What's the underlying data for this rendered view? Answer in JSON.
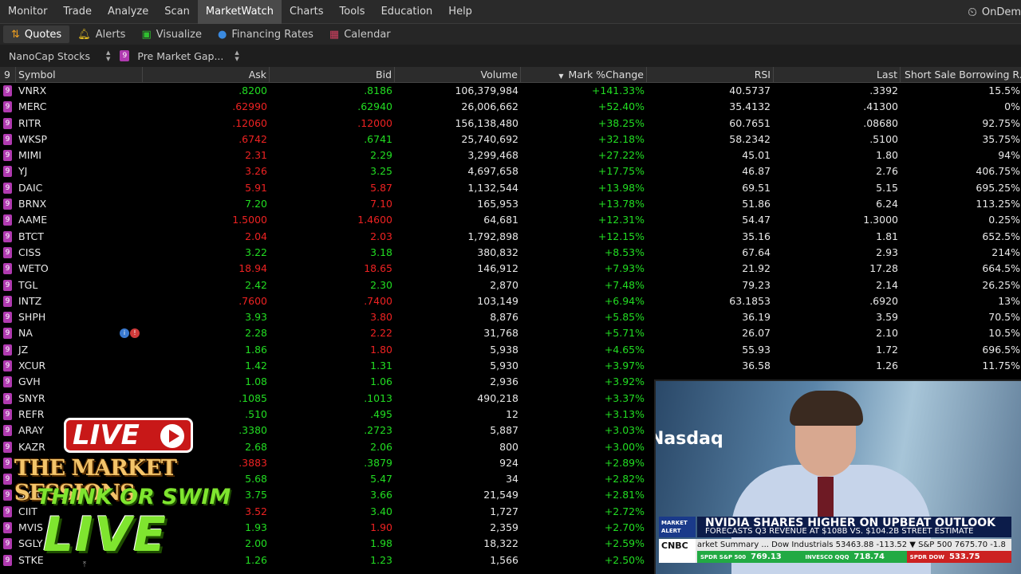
{
  "menu": {
    "items": [
      "Monitor",
      "Trade",
      "Analyze",
      "Scan",
      "MarketWatch",
      "Charts",
      "Tools",
      "Education",
      "Help"
    ],
    "active_index": 4,
    "right_label": "OnDem"
  },
  "subtabs": [
    {
      "label": "Quotes",
      "icon": "sort-arrows-icon",
      "active": true
    },
    {
      "label": "Alerts",
      "icon": "bell-icon",
      "active": false
    },
    {
      "label": "Visualize",
      "icon": "chart-icon",
      "active": false
    },
    {
      "label": "Financing Rates",
      "icon": "globe-icon",
      "active": false
    },
    {
      "label": "Calendar",
      "icon": "calendar-icon",
      "active": false
    }
  ],
  "watchlist": {
    "name": "NanoCap Stocks",
    "scan_name": "Pre Market Gap...",
    "tag": "9"
  },
  "table": {
    "count_label": "9",
    "headers": {
      "symbol": "Symbol",
      "ask": "Ask",
      "bid": "Bid",
      "volume": "Volume",
      "mark_change": "Mark %Change",
      "rsi": "RSI",
      "last": "Last",
      "short": "Short Sale Borrowing R..."
    },
    "rows": [
      {
        "sym": "VNRX",
        "ask": ".8200",
        "ask_c": "g",
        "bid": ".8186",
        "bid_c": "g",
        "vol": "106,379,984",
        "chg": "+141.33%",
        "rsi": "40.5737",
        "last": ".3392",
        "short": "15.5%"
      },
      {
        "sym": "MERC",
        "ask": ".62990",
        "ask_c": "rd",
        "bid": ".62940",
        "bid_c": "g",
        "vol": "26,006,662",
        "chg": "+52.40%",
        "rsi": "35.4132",
        "last": ".41300",
        "short": "0%"
      },
      {
        "sym": "RITR",
        "ask": ".12060",
        "ask_c": "rd",
        "bid": ".12000",
        "bid_c": "rd",
        "vol": "156,138,480",
        "chg": "+38.25%",
        "rsi": "60.7651",
        "last": ".08680",
        "short": "92.75%"
      },
      {
        "sym": "WKSP",
        "ask": ".6742",
        "ask_c": "rd",
        "bid": ".6741",
        "bid_c": "g",
        "vol": "25,740,692",
        "chg": "+32.18%",
        "rsi": "58.2342",
        "last": ".5100",
        "short": "35.75%"
      },
      {
        "sym": "MIMI",
        "ask": "2.31",
        "ask_c": "rd",
        "bid": "2.29",
        "bid_c": "g",
        "vol": "3,299,468",
        "chg": "+27.22%",
        "rsi": "45.01",
        "last": "1.80",
        "short": "94%"
      },
      {
        "sym": "YJ",
        "ask": "3.26",
        "ask_c": "rd",
        "bid": "3.25",
        "bid_c": "g",
        "vol": "4,697,658",
        "chg": "+17.75%",
        "rsi": "46.87",
        "last": "2.76",
        "short": "406.75%"
      },
      {
        "sym": "DAIC",
        "ask": "5.91",
        "ask_c": "rd",
        "bid": "5.87",
        "bid_c": "rd",
        "vol": "1,132,544",
        "chg": "+13.98%",
        "rsi": "69.51",
        "last": "5.15",
        "short": "695.25%"
      },
      {
        "sym": "BRNX",
        "ask": "7.20",
        "ask_c": "g",
        "bid": "7.10",
        "bid_c": "rd",
        "vol": "165,953",
        "chg": "+13.78%",
        "rsi": "51.86",
        "last": "6.24",
        "short": "113.25%"
      },
      {
        "sym": "AAME",
        "ask": "1.5000",
        "ask_c": "rd",
        "bid": "1.4600",
        "bid_c": "rd",
        "vol": "64,681",
        "chg": "+12.31%",
        "rsi": "54.47",
        "last": "1.3000",
        "short": "0.25%"
      },
      {
        "sym": "BTCT",
        "ask": "2.04",
        "ask_c": "rd",
        "bid": "2.03",
        "bid_c": "rd",
        "vol": "1,792,898",
        "chg": "+12.15%",
        "rsi": "35.16",
        "last": "1.81",
        "short": "652.5%"
      },
      {
        "sym": "CISS",
        "ask": "3.22",
        "ask_c": "g",
        "bid": "3.18",
        "bid_c": "g",
        "vol": "380,832",
        "chg": "+8.53%",
        "rsi": "67.64",
        "last": "2.93",
        "short": "214%"
      },
      {
        "sym": "WETO",
        "ask": "18.94",
        "ask_c": "rd",
        "bid": "18.65",
        "bid_c": "rd",
        "vol": "146,912",
        "chg": "+7.93%",
        "rsi": "21.92",
        "last": "17.28",
        "short": "664.5%"
      },
      {
        "sym": "TGL",
        "ask": "2.42",
        "ask_c": "g",
        "bid": "2.30",
        "bid_c": "g",
        "vol": "2,870",
        "chg": "+7.48%",
        "rsi": "79.23",
        "last": "2.14",
        "short": "26.25%"
      },
      {
        "sym": "INTZ",
        "ask": ".7600",
        "ask_c": "rd",
        "bid": ".7400",
        "bid_c": "rd",
        "vol": "103,149",
        "chg": "+6.94%",
        "rsi": "63.1853",
        "last": ".6920",
        "short": "13%"
      },
      {
        "sym": "SHPH",
        "ask": "3.93",
        "ask_c": "g",
        "bid": "3.80",
        "bid_c": "rd",
        "vol": "8,876",
        "chg": "+5.85%",
        "rsi": "36.19",
        "last": "3.59",
        "short": "70.5%"
      },
      {
        "sym": "NA",
        "ask": "2.28",
        "ask_c": "g",
        "bid": "2.22",
        "bid_c": "rd",
        "vol": "31,768",
        "chg": "+5.71%",
        "rsi": "26.07",
        "last": "2.10",
        "short": "10.5%",
        "badges": true
      },
      {
        "sym": "JZ",
        "ask": "1.86",
        "ask_c": "g",
        "bid": "1.80",
        "bid_c": "rd",
        "vol": "5,938",
        "chg": "+4.65%",
        "rsi": "55.93",
        "last": "1.72",
        "short": "696.5%"
      },
      {
        "sym": "XCUR",
        "ask": "1.42",
        "ask_c": "g",
        "bid": "1.31",
        "bid_c": "g",
        "vol": "5,930",
        "chg": "+3.97%",
        "rsi": "36.58",
        "last": "1.26",
        "short": "11.75%"
      },
      {
        "sym": "GVH",
        "ask": "1.08",
        "ask_c": "g",
        "bid": "1.06",
        "bid_c": "g",
        "vol": "2,936",
        "chg": "+3.92%",
        "rsi": "",
        "last": "",
        "short": ""
      },
      {
        "sym": "SNYR",
        "ask": ".1085",
        "ask_c": "g",
        "bid": ".1013",
        "bid_c": "g",
        "vol": "490,218",
        "chg": "+3.37%",
        "rsi": "",
        "last": "",
        "short": ""
      },
      {
        "sym": "REFR",
        "ask": ".510",
        "ask_c": "g",
        "bid": ".495",
        "bid_c": "g",
        "vol": "12",
        "chg": "+3.13%",
        "rsi": "",
        "last": "",
        "short": ""
      },
      {
        "sym": "ARAY",
        "ask": ".3380",
        "ask_c": "g",
        "bid": ".2723",
        "bid_c": "g",
        "vol": "5,887",
        "chg": "+3.03%",
        "rsi": "",
        "last": "",
        "short": ""
      },
      {
        "sym": "KAZR",
        "ask": "2.68",
        "ask_c": "g",
        "bid": "2.06",
        "bid_c": "g",
        "vol": "800",
        "chg": "+3.00%",
        "rsi": "",
        "last": "",
        "short": ""
      },
      {
        "sym": "",
        "ask": ".3883",
        "ask_c": "rd",
        "bid": ".3879",
        "bid_c": "g",
        "vol": "924",
        "chg": "+2.89%",
        "rsi": "",
        "last": "",
        "short": ""
      },
      {
        "sym": "",
        "ask": "5.68",
        "ask_c": "g",
        "bid": "5.47",
        "bid_c": "g",
        "vol": "34",
        "chg": "+2.82%",
        "rsi": "",
        "last": "",
        "short": ""
      },
      {
        "sym": "SXTC",
        "ask": "3.75",
        "ask_c": "g",
        "bid": "3.66",
        "bid_c": "g",
        "vol": "21,549",
        "chg": "+2.81%",
        "rsi": "",
        "last": "",
        "short": ""
      },
      {
        "sym": "CIIT",
        "ask": "3.52",
        "ask_c": "rd",
        "bid": "3.40",
        "bid_c": "g",
        "vol": "1,727",
        "chg": "+2.72%",
        "rsi": "",
        "last": "",
        "short": ""
      },
      {
        "sym": "MVIS",
        "ask": "1.93",
        "ask_c": "g",
        "bid": "1.90",
        "bid_c": "rd",
        "vol": "2,359",
        "chg": "+2.70%",
        "rsi": "",
        "last": "",
        "short": ""
      },
      {
        "sym": "SGLY",
        "ask": "2.00",
        "ask_c": "g",
        "bid": "1.98",
        "bid_c": "g",
        "vol": "18,322",
        "chg": "+2.59%",
        "rsi": "",
        "last": "",
        "short": ""
      },
      {
        "sym": "STKE",
        "ask": "1.26",
        "ask_c": "g",
        "bid": "1.23",
        "bid_c": "g",
        "vol": "1,566",
        "chg": "+2.50%",
        "rsi": "",
        "last": "",
        "short": ""
      }
    ]
  },
  "overlay": {
    "live_top": "LIVE",
    "market_sessions": "THE MARKET SESSIONS",
    "tos": "THINK OR SWIM",
    "live_big": "LIVE"
  },
  "video": {
    "bg_text": "Nasdaq",
    "alert_label": "MARKET ALERT",
    "headline": "NVIDIA SHARES HIGHER ON UPBEAT OUTLOOK",
    "subheadline": "FORECASTS Q3 REVENUE AT $108B VS. $104.2B STREET ESTIMATE",
    "network": "CNBC",
    "ticker_top": "arket Summary ...   Dow Industrials 53463.88 -113.52  ▼   S&P 500 7675.70 -1.8",
    "ticker_segments": [
      {
        "label": "SPDR S&P 500",
        "value": "769.13",
        "color": "#22aa44"
      },
      {
        "label": "INVESCO QQQ",
        "value": "718.74",
        "color": "#22aa44"
      },
      {
        "label": "SPDR DOW",
        "value": "533.75",
        "color": "#cc2222"
      }
    ]
  }
}
